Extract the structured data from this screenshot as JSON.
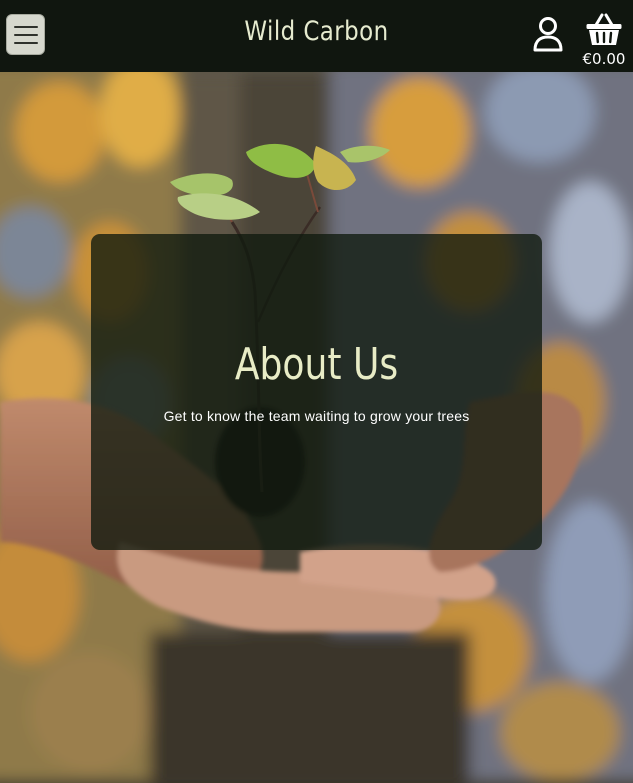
{
  "navbar": {
    "brand": "Wild Carbon",
    "menu_icon": "hamburger-menu-icon",
    "account_icon": "user-icon",
    "basket_icon": "basket-icon",
    "basket_total": "€0.00"
  },
  "hero": {
    "title": "About Us",
    "subtitle": "Get to know the team waiting to grow your trees",
    "image": "hands-holding-sapling-photo"
  },
  "colors": {
    "navbar_bg": "#10160f",
    "brand_text": "#e6ebcf",
    "card_bg": "rgba(16,26,14,0.78)",
    "title_text": "#e8ecc6"
  }
}
